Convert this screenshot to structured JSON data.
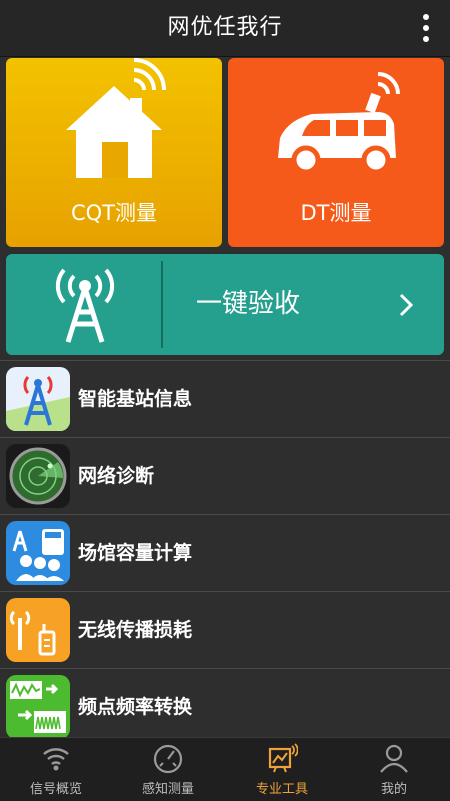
{
  "app": {
    "title": "网优任我行"
  },
  "tiles": {
    "cqt": {
      "label": "CQT测量",
      "color": "#f0b400"
    },
    "dt": {
      "label": "DT测量",
      "color": "#f55a1b"
    }
  },
  "accept": {
    "label": "一键验收",
    "color": "#25a08f"
  },
  "list": [
    {
      "label": "智能基站信息",
      "icon": "base-station-icon"
    },
    {
      "label": "网络诊断",
      "icon": "radar-icon"
    },
    {
      "label": "场馆容量计算",
      "icon": "venue-capacity-icon"
    },
    {
      "label": "无线传播损耗",
      "icon": "propagation-loss-icon"
    },
    {
      "label": "频点频率转换",
      "icon": "frequency-convert-icon"
    }
  ],
  "tabs": [
    {
      "label": "信号概览",
      "icon": "wifi-signal-icon",
      "active": false
    },
    {
      "label": "感知测量",
      "icon": "gauge-icon",
      "active": false
    },
    {
      "label": "专业工具",
      "icon": "tools-chart-icon",
      "active": true
    },
    {
      "label": "我的",
      "icon": "user-icon",
      "active": false
    }
  ],
  "colors": {
    "active_tab": "#f0a23a",
    "inactive_tab": "#bdbdbd"
  }
}
